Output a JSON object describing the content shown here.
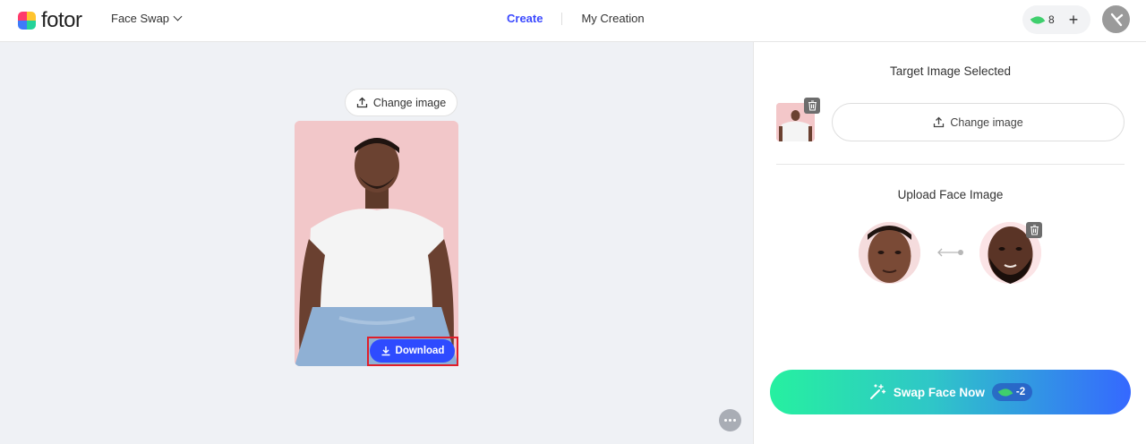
{
  "header": {
    "logo_text": "fotor",
    "tool_select": "Face Swap",
    "nav": {
      "create": "Create",
      "my_creation": "My Creation"
    },
    "credits": "8",
    "accent_color": "#3b49ff"
  },
  "canvas": {
    "change_image_label": "Change image",
    "download_label": "Download",
    "download_highlight_color": "#e01e2a"
  },
  "panel": {
    "target_title": "Target Image Selected",
    "change_image_label": "Change image",
    "upload_face_title": "Upload Face Image",
    "swap_button_label": "Swap Face Now",
    "swap_cost": "-2"
  },
  "icons": [
    "upload-icon",
    "download-icon",
    "trash-icon",
    "more-icon",
    "leaf-icon",
    "plus-icon",
    "magic-wand-icon",
    "chevron-down-icon",
    "arrow-icon"
  ]
}
